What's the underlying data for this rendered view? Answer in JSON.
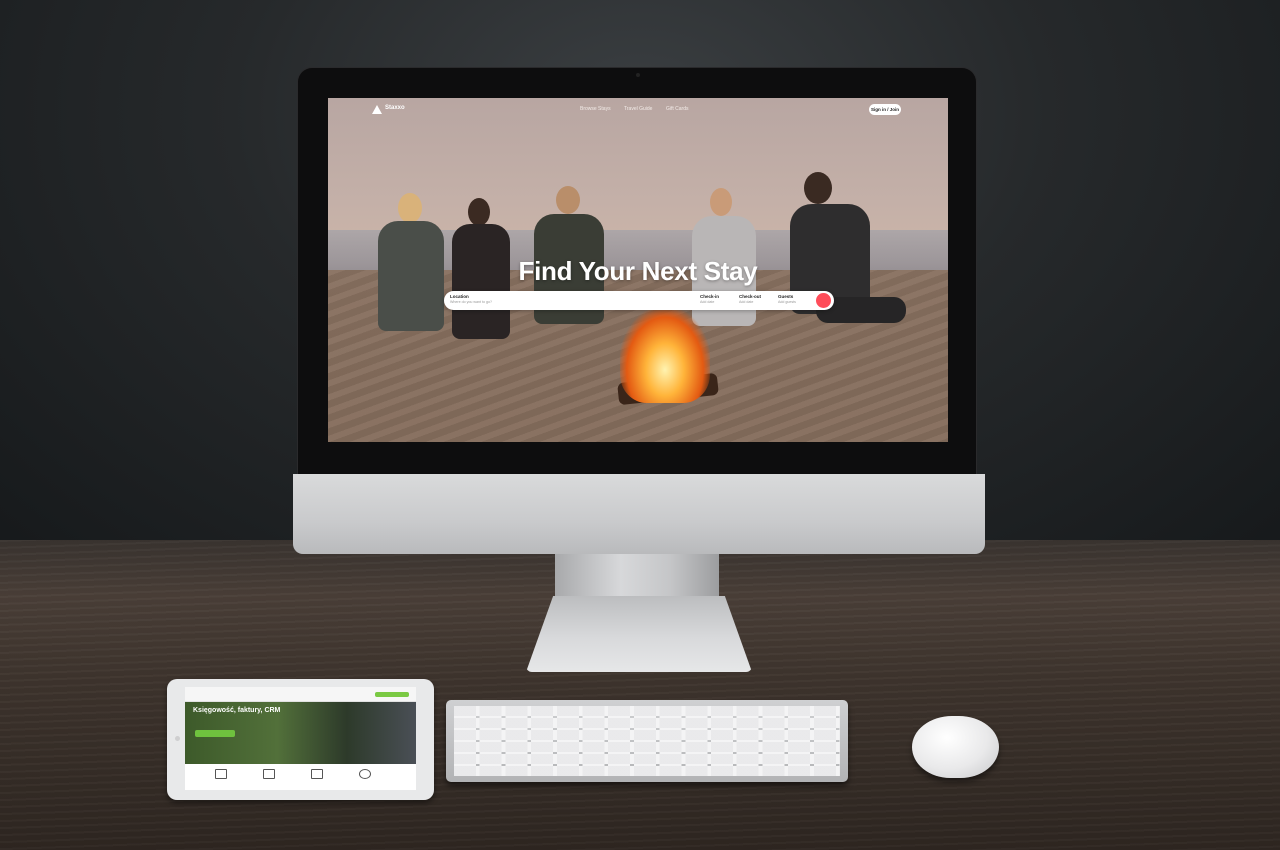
{
  "site": {
    "logo_text": "Staxxo",
    "nav_links": [
      "Browse Stays",
      "Travel Guide",
      "Gift Cards"
    ],
    "nav_button": "Sign in / Join",
    "hero_title": "Find Your Next Stay",
    "search": {
      "location_label": "Location",
      "location_hint": "Where do you want to go?",
      "checkin_label": "Check-in",
      "checkin_hint": "Add date",
      "checkout_label": "Check-out",
      "checkout_hint": "Add date",
      "guests_label": "Guests",
      "guests_hint": "Add guests"
    }
  },
  "tablet": {
    "headline": "Księgowość, faktury, CRM"
  },
  "colors": {
    "search_button": "#ff4d5a",
    "tablet_accent": "#7ac943"
  }
}
